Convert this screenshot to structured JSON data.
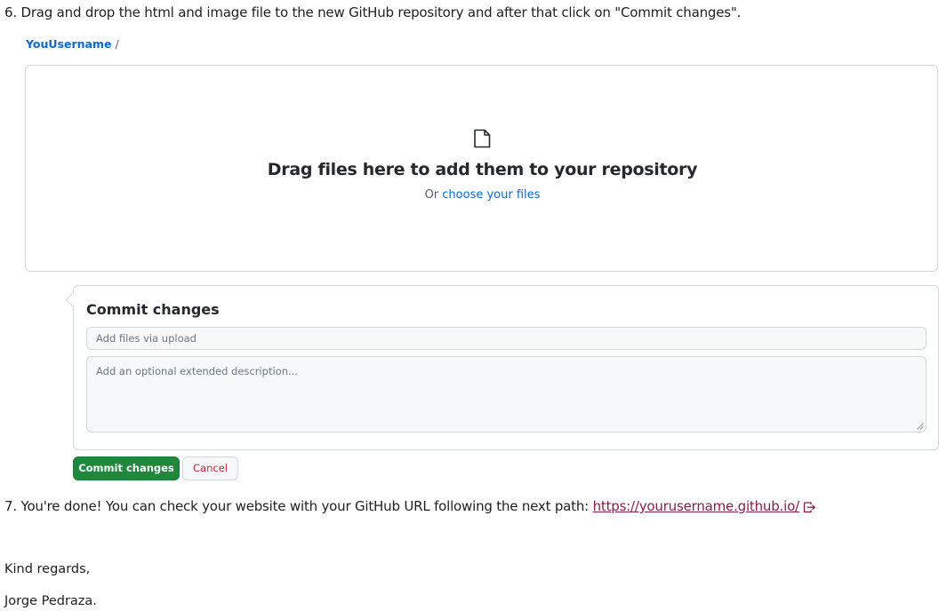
{
  "instructions": {
    "step6": "6. Drag and drop the html and image file to the new GitHub repository and after that click on \"Commit changes\".",
    "step7_text": "7. You're done! You can check your website with your GitHub URL following the next path: ",
    "step7_link": "https://yourusername.github.io/",
    "step7_link_icon": "external-link-icon"
  },
  "breadcrumb": {
    "owner": "YouUsername",
    "separator": "/"
  },
  "dropzone": {
    "icon": "file-icon",
    "title": "Drag files here to add them to your repository",
    "sub_prefix": "Or ",
    "sub_link": "choose your files"
  },
  "commit": {
    "title": "Commit changes",
    "summary_placeholder": "Add files via upload",
    "description_placeholder": "Add an optional extended description...",
    "commit_button": "Commit changes",
    "cancel_button": "Cancel"
  },
  "closing": {
    "regards": "Kind regards,",
    "signature": "Jorge Pedraza."
  },
  "colors": {
    "accent_blue": "#0969da",
    "commit_green": "#1f883d",
    "cancel_red": "#cf222e",
    "link_visited": "#8b1b4a"
  }
}
